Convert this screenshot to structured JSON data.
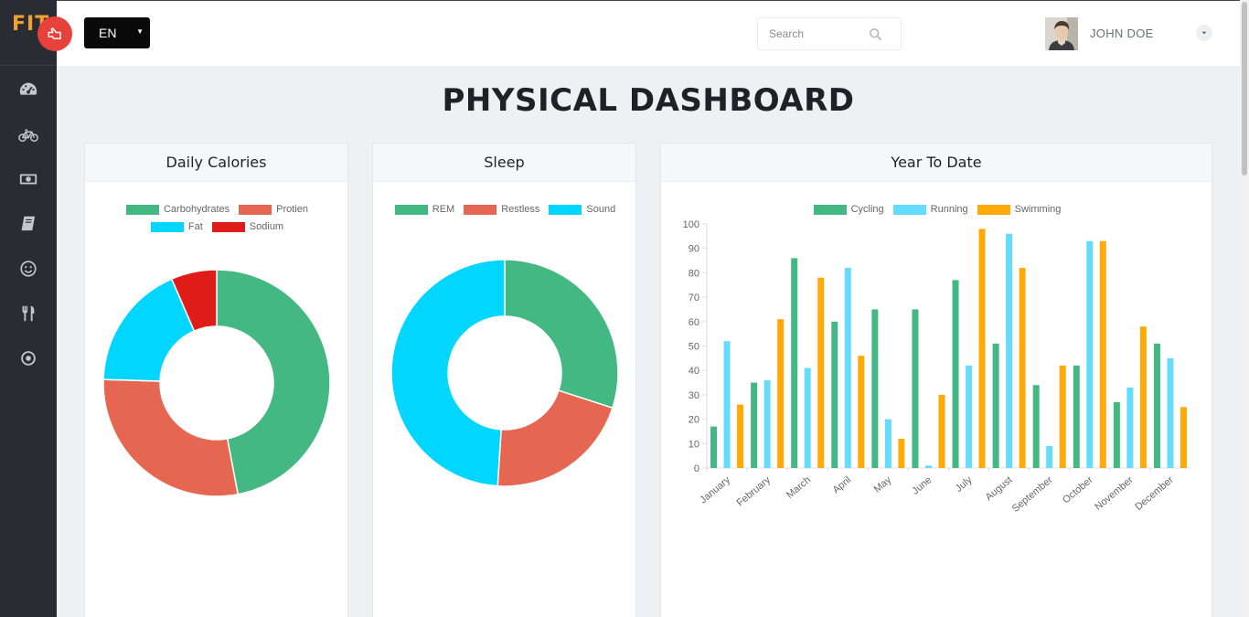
{
  "app": {
    "logo": "FIT",
    "language": "EN",
    "search_placeholder": "Search",
    "username": "JOHN DOE",
    "page_title": "PHYSICAL DASHBOARD"
  },
  "sidebar": {
    "items": [
      {
        "icon": "dashboard-icon"
      },
      {
        "icon": "bicycle-icon"
      },
      {
        "icon": "money-icon"
      },
      {
        "icon": "book-icon"
      },
      {
        "icon": "smile-icon"
      },
      {
        "icon": "utensils-icon"
      },
      {
        "icon": "target-icon"
      }
    ]
  },
  "colors": {
    "green": "#44b883",
    "red": "#e56651",
    "cyan": "#00d6ff",
    "darkred": "#df1c18",
    "lightblue": "#66dcfd",
    "orange": "#ffaa09"
  },
  "cards": {
    "calories": {
      "title": "Daily Calories"
    },
    "sleep": {
      "title": "Sleep"
    },
    "ytd": {
      "title": "Year To Date"
    }
  },
  "chart_data": [
    {
      "type": "pie",
      "title": "Daily Calories",
      "labels": [
        "Carbohydrates",
        "Protien",
        "Fat",
        "Sodium"
      ],
      "values": [
        47,
        28.5,
        18,
        6.5
      ],
      "colors": [
        "#44b883",
        "#e56651",
        "#00d6ff",
        "#df1c18"
      ],
      "legend": "top"
    },
    {
      "type": "pie",
      "title": "Sleep",
      "labels": [
        "REM",
        "Restless",
        "Sound"
      ],
      "values": [
        30,
        21,
        49
      ],
      "colors": [
        "#44b883",
        "#e56651",
        "#00d6ff"
      ],
      "legend": "top"
    },
    {
      "type": "bar",
      "title": "Year To Date",
      "categories": [
        "January",
        "February",
        "March",
        "April",
        "May",
        "June",
        "July",
        "August",
        "September",
        "October",
        "November",
        "December"
      ],
      "series": [
        {
          "name": "Cycling",
          "color": "#44b883",
          "values": [
            17,
            35,
            86,
            60,
            65,
            65,
            77,
            51,
            34,
            42,
            27,
            51
          ]
        },
        {
          "name": "Running",
          "color": "#66dcfd",
          "values": [
            52,
            36,
            41,
            82,
            20,
            1,
            42,
            96,
            9,
            93,
            33,
            45
          ]
        },
        {
          "name": "Swimming",
          "color": "#ffaa09",
          "values": [
            26,
            61,
            78,
            46,
            12,
            30,
            98,
            82,
            42,
            93,
            58,
            25
          ]
        }
      ],
      "ylim": [
        0,
        100
      ],
      "yticks": [
        0,
        10,
        20,
        30,
        40,
        50,
        60,
        70,
        80,
        90,
        100
      ],
      "legend": "top",
      "grid": false
    }
  ]
}
